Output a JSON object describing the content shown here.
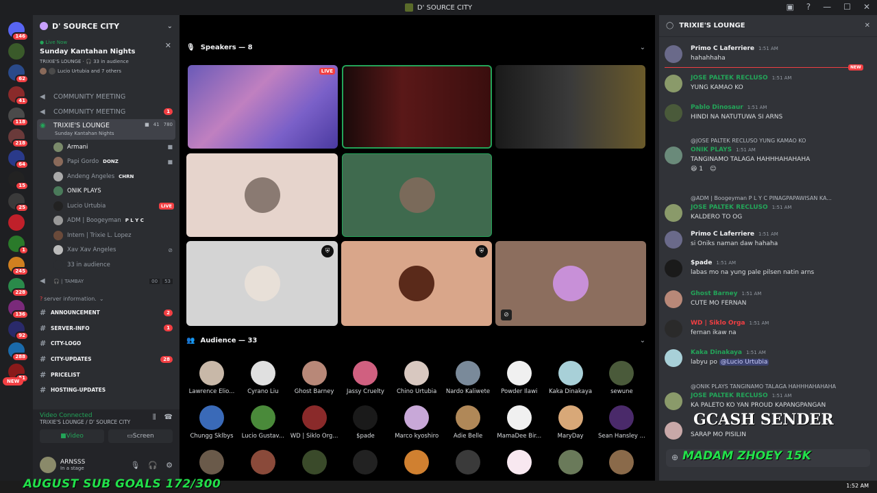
{
  "window": {
    "title": "D' SOURCE CITY"
  },
  "servers": [
    {
      "badge": "146",
      "color": "#5865f2"
    },
    {
      "badge": "",
      "color": "#3a5a2a"
    },
    {
      "badge": "62",
      "color": "#2a4a8a"
    },
    {
      "badge": "41",
      "color": "#8a2a2a"
    },
    {
      "badge": "118",
      "color": "#4a4a4a"
    },
    {
      "badge": "218",
      "color": "#6a3a3a"
    },
    {
      "badge": "64",
      "color": "#2a3a8a"
    },
    {
      "badge": "15",
      "color": "#222222"
    },
    {
      "badge": "25",
      "color": "#3a3a3a"
    },
    {
      "badge": "",
      "color": "#c0202a"
    },
    {
      "badge": "1",
      "color": "#2a7a2a"
    },
    {
      "badge": "245",
      "color": "#d08020"
    },
    {
      "badge": "228",
      "color": "#2a8a4a"
    },
    {
      "badge": "136",
      "color": "#7a2a7a"
    },
    {
      "badge": "92",
      "color": "#2a2a6a"
    },
    {
      "badge": "288",
      "color": "#1a6aaa"
    },
    {
      "badge": "51",
      "color": "#8a1a1a"
    }
  ],
  "new_badge": "NEW",
  "sidebar": {
    "server_name": "D' SOURCE CITY",
    "live": {
      "status": "Live Now",
      "event": "Sunday Kantahan Nights",
      "meta": "TRIXIE'S LOUNGE · 🎧 33 in audience",
      "people": "Lucio Urtubia and 7 others"
    },
    "voice_channels": [
      {
        "name": "COMMUNITY MEETING",
        "badge": ""
      },
      {
        "name": "COMMUNITY MEETING",
        "badge": "1"
      }
    ],
    "active_channel": {
      "name": "TRIXIE'S LOUNGE",
      "sub": "Sunday Kantahan Nights",
      "count1": "41",
      "count2": "780"
    },
    "members": [
      {
        "name": "Armani",
        "tag": "",
        "right": "cam",
        "color": "#7a8a6a",
        "bright": true
      },
      {
        "name": "Papi Gordo",
        "tag": "DONZ",
        "right": "cam",
        "color": "#8a6a5a",
        "bright": false
      },
      {
        "name": "Andeng Angeles",
        "tag": "CHRN",
        "right": "",
        "color": "#aaaaaa",
        "bright": false
      },
      {
        "name": "ONIK PLAYS",
        "tag": "",
        "right": "",
        "color": "#4a7a5a",
        "bright": true
      },
      {
        "name": "Lucio Urtubia",
        "tag": "",
        "right": "LIVE",
        "color": "#222222",
        "bright": false
      },
      {
        "name": "ADM | Boogeyman",
        "tag": "P L Y C",
        "right": "",
        "color": "#999999",
        "bright": false
      },
      {
        "name": "Intern | Trixie L. Lopez",
        "tag": "",
        "right": "",
        "color": "#6a4a3a",
        "bright": false
      },
      {
        "name": "Xav Xav Angeles",
        "tag": "",
        "right": "mute",
        "color": "#bbbbbb",
        "bright": false
      },
      {
        "name": "33 in audience",
        "tag": "",
        "right": "",
        "color": "#2b2d31",
        "bright": false
      }
    ],
    "tambay": {
      "name": "TAMBAY",
      "c1": "00",
      "c2": "53"
    },
    "category": "server information.",
    "text_channels": [
      {
        "name": "ANNOUNCEMENT",
        "badge": "2",
        "glyph": "📢"
      },
      {
        "name": "SERVER-INFO",
        "badge": "1",
        "glyph": "📌"
      },
      {
        "name": "CITY-LOGO",
        "badge": "",
        "glyph": "📌"
      },
      {
        "name": "CITY-UPDATES",
        "badge": "28",
        "glyph": "📄"
      },
      {
        "name": "PRICELIST",
        "badge": "",
        "glyph": "👯"
      },
      {
        "name": "HOSTING-UPDATES",
        "badge": "",
        "glyph": ""
      }
    ]
  },
  "voice_panel": {
    "status": "Video Connected",
    "location": "TRIXIE'S LOUNGE / D' SOURCE CITY",
    "video": "Video",
    "screen": "Screen"
  },
  "user": {
    "name": "ARNSSS",
    "status": "In a stage"
  },
  "stage": {
    "speakers_title": "Speakers — 8",
    "audience_title": "Audience — 33",
    "live_label": "LIVE",
    "audience": [
      {
        "name": "Lawrence Elio...",
        "color": "#c8b8a8"
      },
      {
        "name": "Cyrano Liu",
        "color": "#e0e0e0"
      },
      {
        "name": "Ghost Barney",
        "color": "#b88878"
      },
      {
        "name": "Jassy Cruelty",
        "color": "#d06080"
      },
      {
        "name": "Chino Urtubia",
        "color": "#d8c8c0"
      },
      {
        "name": "Nardo Kaliwete",
        "color": "#7a8a9a"
      },
      {
        "name": "Powder Ilawi",
        "color": "#f0f0f0"
      },
      {
        "name": "Kaka Dinakaya",
        "color": "#a8d0d8"
      },
      {
        "name": "sewune",
        "color": "#4a5a3a"
      },
      {
        "name": "Chungg Sklbys",
        "color": "#3a6ab8"
      },
      {
        "name": "Lucio Gustav...",
        "color": "#4a8a3a"
      },
      {
        "name": "WD | Siklo Org...",
        "color": "#8a2a2a"
      },
      {
        "name": "$pade",
        "color": "#1a1a1a"
      },
      {
        "name": "Marco kyoshiro",
        "color": "#c8a8d8"
      },
      {
        "name": "Adie Belle",
        "color": "#b08858"
      },
      {
        "name": "MamaDee Bir...",
        "color": "#f0f0f0"
      },
      {
        "name": "MaryDay",
        "color": "#d8a878"
      },
      {
        "name": "Sean Hansley ...",
        "color": "#4a2a6a"
      },
      {
        "name": "",
        "color": "#6a5a4a"
      },
      {
        "name": "",
        "color": "#8a4a3a"
      },
      {
        "name": "",
        "color": "#3a4a2a"
      },
      {
        "name": "",
        "color": "#222222"
      },
      {
        "name": "",
        "color": "#d08030"
      },
      {
        "name": "",
        "color": "#3a3a3a"
      },
      {
        "name": "",
        "color": "#f8e8f0"
      },
      {
        "name": "",
        "color": "#6a7a5a"
      },
      {
        "name": "",
        "color": "#8a6a4a"
      }
    ]
  },
  "chat": {
    "title": "TRIXIE'S LOUNGE",
    "new_label": "NEW",
    "messages": [
      {
        "name": "Primo C Laferriere",
        "time": "1:51 AM",
        "text": "hahahhaha",
        "color": "#f2f3f5",
        "reply": "",
        "av": "#6a6a8a"
      },
      {
        "name": "JOSE PALTEK RECLUSO",
        "time": "1:51 AM",
        "text": "YUNG KAMAO KO",
        "color": "#23a559",
        "reply": "",
        "av": "#8a9a6a"
      },
      {
        "name": "Pablo Dinosaur",
        "time": "1:51 AM",
        "text": "HINDI NA NATUTUWA SI ARNS",
        "color": "#23a559",
        "reply": "",
        "av": "#4a5a3a"
      },
      {
        "name": "ONIK PLAYS",
        "time": "1:51 AM",
        "text": "TANGINAMO TALAGA HAHHHAHAHAHA",
        "color": "#23a559",
        "reply": "@JOSE PALTEK RECLUSO YUNG KAMAO KO",
        "av": "#6a8a7a"
      },
      {
        "name": "JOSE PALTEK RECLUSO",
        "time": "1:51 AM",
        "text": "KALDERO TO OG",
        "color": "#23a559",
        "reply": "@ADM | Boogeyman P L Y C PINAGPAPAWISAN KA...",
        "av": "#8a9a6a"
      },
      {
        "name": "Primo C Laferriere",
        "time": "1:51 AM",
        "text": "si Oniks naman daw hahaha",
        "color": "#f2f3f5",
        "reply": "",
        "av": "#6a6a8a"
      },
      {
        "name": "$pade",
        "time": "1:51 AM",
        "text": "labas mo na yung pale pilsen natin arns",
        "color": "#f2f3f5",
        "reply": "",
        "av": "#1a1a1a"
      },
      {
        "name": "Ghost Barney",
        "time": "1:51 AM",
        "text": "CUTE MO FERNAN",
        "color": "#23a559",
        "reply": "",
        "av": "#b88878"
      },
      {
        "name": "WD | Siklo Orga",
        "time": "1:51 AM",
        "text": "fernan ikaw na",
        "color": "#f23f43",
        "reply": "",
        "av": "#2a2a2a"
      },
      {
        "name": "Kaka Dinakaya",
        "time": "1:51 AM",
        "text": "labyu po",
        "color": "#23a559",
        "reply": "",
        "av": "#a8d0d8",
        "mention": "@Lucio Urtubia"
      },
      {
        "name": "JOSE PALTEK RECLUSO",
        "time": "1:51 AM",
        "text": "KA PALETO KO YAN PROUD KAPANGPANGAN",
        "color": "#23a559",
        "reply": "@ONIK PLAYS TANGINAMO TALAGA HAHHHAHAHAHA",
        "av": "#8a9a6a"
      },
      {
        "name": "",
        "time": "",
        "text": "SARAP MO PISILIN",
        "color": "#f2f3f5",
        "reply": "",
        "av": "#c8a8a8"
      }
    ],
    "reaction": {
      "emoji": "😆",
      "count": "1"
    }
  },
  "overlays": {
    "gcash": "GCASH SENDER",
    "donor": "MADAM ZHOEY 15K",
    "subgoal": "AUGUST SUB GOALS 172/300"
  },
  "clock": "1:52 AM"
}
